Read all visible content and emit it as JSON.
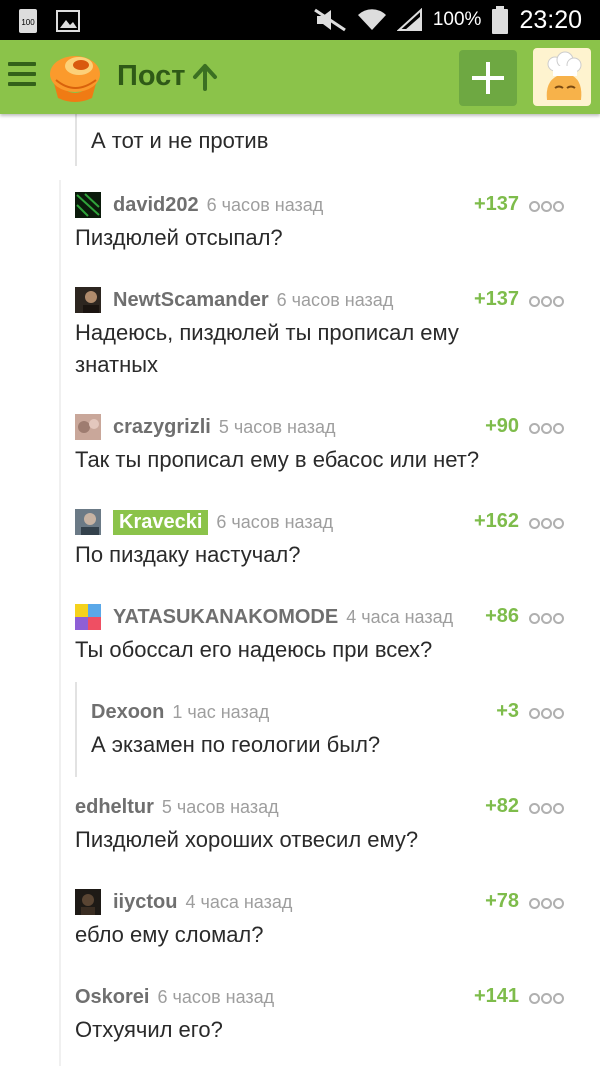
{
  "status_bar": {
    "battery_badge": "100",
    "battery_percent": "100%",
    "time": "23:20"
  },
  "header": {
    "title": "Пост"
  },
  "comments": [
    {
      "user": "",
      "time": "",
      "rating": "",
      "text": "А тот и не против"
    },
    {
      "user": "david202",
      "time": "6 часов назад",
      "rating": "+137",
      "text": "Пиздюлей отсыпал?"
    },
    {
      "user": "NewtScamander",
      "time": "6 часов назад",
      "rating": "+137",
      "text": "Надеюсь, пиздюлей ты прописал ему знатных"
    },
    {
      "user": "crazygrizli",
      "time": "5 часов назад",
      "rating": "+90",
      "text": "Так ты прописал ему в ебасос или нет?"
    },
    {
      "user": "Kravecki",
      "time": "6 часов назад",
      "rating": "+162",
      "text": "По пиздаку настучал?"
    },
    {
      "user": "YATASUKANAKOMODE",
      "time": "4 часа назад",
      "rating": "+86",
      "text": "Ты обоссал его надеюсь при всех?"
    },
    {
      "user": "Dexoon",
      "time": "1 час назад",
      "rating": "+3",
      "text": "А экзамен по геологии был?"
    },
    {
      "user": "edheltur",
      "time": "5 часов назад",
      "rating": "+82",
      "text": "Пиздюлей хороших отвесил ему?"
    },
    {
      "user": "iiyctou",
      "time": "4 часа назад",
      "rating": "+78",
      "text": "ебло ему сломал?"
    },
    {
      "user": "Oskorei",
      "time": "6 часов назад",
      "rating": "+141",
      "text": "Отхуячил его?"
    }
  ]
}
